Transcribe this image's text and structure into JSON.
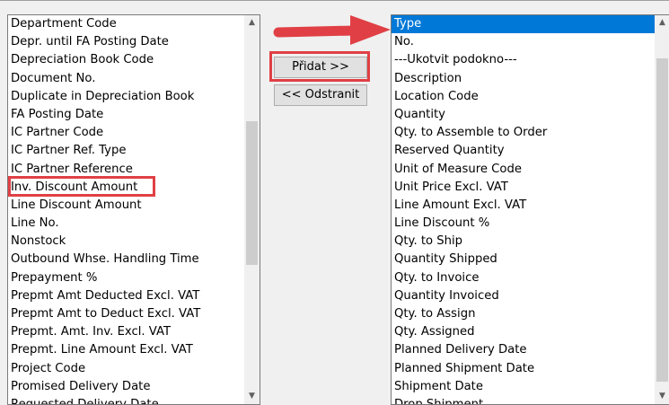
{
  "left_list": {
    "items": [
      "Department Code",
      "Depr. until FA Posting Date",
      "Depreciation Book Code",
      "Document No.",
      "Duplicate in Depreciation Book",
      "FA Posting Date",
      "IC Partner Code",
      "IC Partner Ref. Type",
      "IC Partner Reference",
      "Inv. Discount Amount",
      "Line Discount Amount",
      "Line No.",
      "Nonstock",
      "Outbound Whse. Handling Time",
      "Prepayment %",
      "Prepmt Amt Deducted Excl. VAT",
      "Prepmt Amt to Deduct Excl. VAT",
      "Prepmt. Amt. Inv. Excl. VAT",
      "Prepmt. Line Amount Excl. VAT",
      "Project Code",
      "Promised Delivery Date",
      "Requested Delivery Date"
    ],
    "highlighted_item": "Inv. Discount Amount"
  },
  "buttons": {
    "add_label": "Přidat >>",
    "remove_label": "<< Odstranit"
  },
  "right_list": {
    "selected_item": "Type",
    "items": [
      "Type",
      "No.",
      "---Ukotvit podokno---",
      "Description",
      "Location Code",
      "Quantity",
      "Qty. to Assemble to Order",
      "Reserved Quantity",
      "Unit of Measure Code",
      "Unit Price Excl. VAT",
      "Line Amount Excl. VAT",
      "Line Discount %",
      "Qty. to Ship",
      "Quantity Shipped",
      "Qty. to Invoice",
      "Quantity Invoiced",
      "Qty. to Assign",
      "Qty. Assigned",
      "Planned Delivery Date",
      "Planned Shipment Date",
      "Shipment Date",
      "Drop Shipment"
    ]
  },
  "icons": {
    "scroll_up": "chevron-up-icon",
    "scroll_down": "chevron-down-icon",
    "annotation": "red-arrow-icon"
  },
  "colors": {
    "selection": "#0078d7",
    "annotation_red": "#e04045"
  }
}
